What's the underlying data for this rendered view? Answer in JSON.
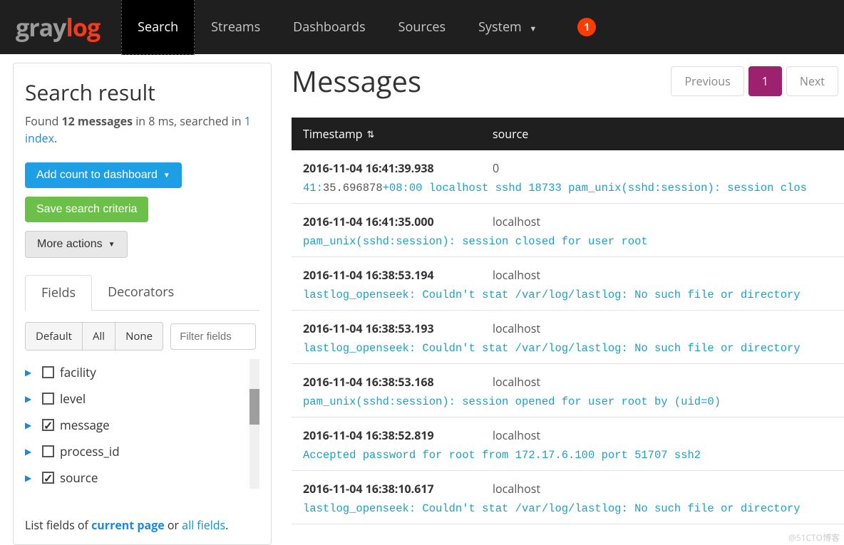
{
  "logo": {
    "part1": "gray",
    "part2": "log"
  },
  "nav": {
    "items": [
      "Search",
      "Streams",
      "Dashboards",
      "Sources",
      "System"
    ],
    "active": 0,
    "badge": "1"
  },
  "sidebar": {
    "title": "Search result",
    "found_prefix": "Found ",
    "found_count": "12 messages",
    "found_suffix": "  in 8 ms, searched in ",
    "index_link": "1 index",
    "period": ".",
    "btn_dashboard": "Add count to dashboard",
    "btn_save": "Save search criteria",
    "btn_more": "More actions",
    "tabs": [
      "Fields",
      "Decorators"
    ],
    "seg": [
      "Default",
      "All",
      "None"
    ],
    "filter_placeholder": "Filter fields",
    "fields": [
      {
        "name": "facility",
        "checked": false
      },
      {
        "name": "level",
        "checked": false
      },
      {
        "name": "message",
        "checked": true
      },
      {
        "name": "process_id",
        "checked": false
      },
      {
        "name": "source",
        "checked": true
      }
    ],
    "footer_prefix": "List fields of ",
    "footer_current": "current page",
    "footer_or": " or ",
    "footer_all": "all fields",
    "footer_period": "."
  },
  "main": {
    "title": "Messages",
    "pager": {
      "prev": "Previous",
      "current": "1",
      "next": "Next"
    },
    "columns": {
      "timestamp": "Timestamp",
      "source": "source"
    },
    "rows": [
      {
        "ts": "2016-11-04 16:41:39.938",
        "src": "0",
        "msg_pre": "41:",
        "msg_hl": "35.696878",
        "msg_post": "+08:00 localhost sshd 18733 pam_unix(sshd:session): session clos"
      },
      {
        "ts": "2016-11-04 16:41:35.000",
        "src": "localhost",
        "msg": "pam_unix(sshd:session): session closed for user root"
      },
      {
        "ts": "2016-11-04 16:38:53.194",
        "src": "localhost",
        "msg": "lastlog_openseek: Couldn't stat /var/log/lastlog: No such file or directory"
      },
      {
        "ts": "2016-11-04 16:38:53.193",
        "src": "localhost",
        "msg": "lastlog_openseek: Couldn't stat /var/log/lastlog: No such file or directory"
      },
      {
        "ts": "2016-11-04 16:38:53.168",
        "src": "localhost",
        "msg": "pam_unix(sshd:session): session opened for user root by (uid=0)"
      },
      {
        "ts": "2016-11-04 16:38:52.819",
        "src": "localhost",
        "msg": "Accepted password for root from 172.17.6.100 port 51707 ssh2"
      },
      {
        "ts": "2016-11-04 16:38:10.617",
        "src": "localhost",
        "msg": "lastlog_openseek: Couldn't stat /var/log/lastlog: No such file or directory"
      }
    ]
  },
  "watermark": "@51CTO博客"
}
